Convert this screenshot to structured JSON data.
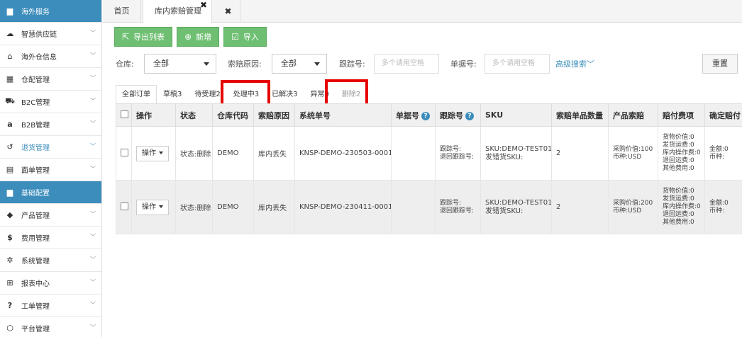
{
  "sidebar": {
    "items": [
      {
        "label": "海外服务",
        "icon": "folder-icon",
        "active": true
      },
      {
        "label": "智慧供应链",
        "icon": "cloud-icon"
      },
      {
        "label": "海外仓信息",
        "icon": "home-icon"
      },
      {
        "label": "仓配管理",
        "icon": "grid-icon"
      },
      {
        "label": "B2C管理",
        "icon": "cart-icon"
      },
      {
        "label": "B2B管理",
        "icon": "amazon-icon"
      },
      {
        "label": "退货管理",
        "icon": "undo-icon",
        "highlight": true
      },
      {
        "label": "面单管理",
        "icon": "document-icon"
      },
      {
        "label": "基础配置",
        "icon": "folder-icon",
        "active": true
      },
      {
        "label": "产品管理",
        "icon": "tag-icon"
      },
      {
        "label": "费用管理",
        "icon": "dollar-icon"
      },
      {
        "label": "系统管理",
        "icon": "gear-icon"
      },
      {
        "label": "报表中心",
        "icon": "table-icon"
      },
      {
        "label": "工单管理",
        "icon": "question-icon"
      },
      {
        "label": "平台管理",
        "icon": "cube-icon"
      }
    ]
  },
  "tabs": {
    "home": "首页",
    "current": "库内索赔管理",
    "close": "✖",
    "extra": "✖"
  },
  "toolbar": {
    "export": "导出列表",
    "add": "新增",
    "import": "导入"
  },
  "filters": {
    "warehouse_label": "仓库:",
    "warehouse_value": "全部",
    "reason_label": "索赔原因:",
    "reason_value": "全部",
    "tracking_label": "跟踪号:",
    "tracking_placeholder": "多个请用空格",
    "order_label": "单据号:",
    "order_placeholder": "多个请用空格",
    "advanced": "高级搜索",
    "reset": "重置"
  },
  "status_tabs": [
    "全部订单",
    "草稿3",
    "待受理2",
    "处理中3",
    "已解决3",
    "异常0",
    "删除2"
  ],
  "table": {
    "headers": [
      "",
      "操作",
      "状态",
      "仓库代码",
      "索赔原因",
      "系统单号",
      "单据号",
      "跟踪号",
      "SKU",
      "索赔单品数量",
      "产品索赔",
      "赔付费项",
      "确定赔付"
    ],
    "rows": [
      {
        "op": "操作",
        "status": "状态:删除",
        "warehouse": "DEMO",
        "reason": "库内丢失",
        "sysno": "KNSP-DEMO-230503-0001",
        "orderno": "",
        "tracking": [
          "跟踪号:",
          "退回跟踪号:"
        ],
        "sku": [
          "SKU:DEMO-TEST01",
          "发错货SKU:"
        ],
        "qty": "2",
        "product_claim": [
          "采购价值:100",
          "币种:USD"
        ],
        "fees": [
          "货物价值:0",
          "发货运费:0",
          "库内操作费:0",
          "退回运费:0",
          "其他费用:0"
        ],
        "confirm": [
          "金额:0",
          "币种:"
        ]
      },
      {
        "op": "操作",
        "status": "状态:删除",
        "warehouse": "DEMO",
        "reason": "库内丢失",
        "sysno": "KNSP-DEMO-230411-0001",
        "orderno": "",
        "tracking": [
          "跟踪号:",
          "退回跟踪号:"
        ],
        "sku": [
          "SKU:DEMO-TEST01",
          "发错货SKU:"
        ],
        "qty": "2",
        "product_claim": [
          "采购价值:200",
          "币种:USD"
        ],
        "fees": [
          "货物价值:0",
          "发货运费:0",
          "库内操作费:0",
          "退回运费:0",
          "其他费用:0"
        ],
        "confirm": [
          "金额:0",
          "币种:"
        ]
      }
    ]
  },
  "colors": {
    "sidebar_active": "#3c8dbc",
    "button_green": "#6fbf73",
    "highlight_red": "#e60000"
  }
}
